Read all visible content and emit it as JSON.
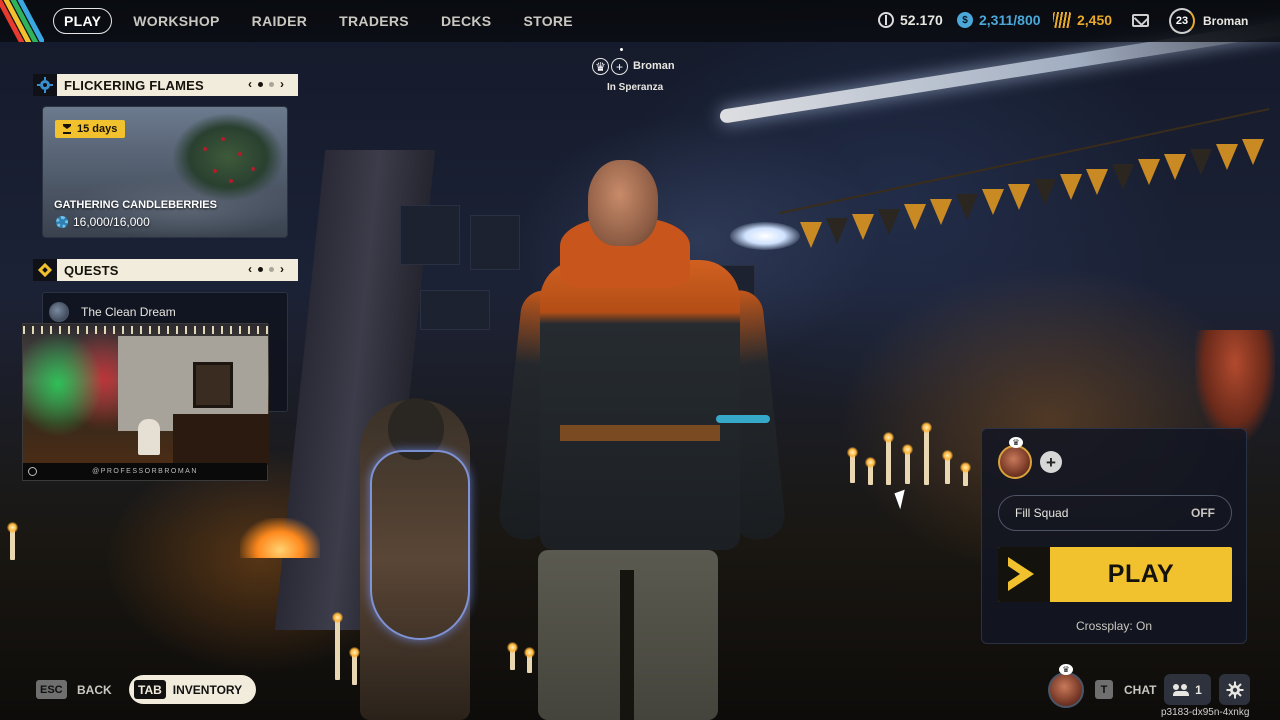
{
  "nav": {
    "items": [
      {
        "label": "PLAY",
        "active": true
      },
      {
        "label": "WORKSHOP",
        "active": false
      },
      {
        "label": "RAIDER",
        "active": false
      },
      {
        "label": "TRADERS",
        "active": false
      },
      {
        "label": "DECKS",
        "active": false
      },
      {
        "label": "STORE",
        "active": false
      }
    ]
  },
  "currencies": {
    "coins": "52.170",
    "blue": "2,311/800",
    "gold": "2,450"
  },
  "player": {
    "level": "23",
    "name": "Broman"
  },
  "party": {
    "leader": "Broman",
    "location": "In Speranza"
  },
  "event_panel": {
    "title": "FLICKERING FLAMES",
    "timer": "15 days",
    "event_name": "GATHERING CANDLEBERRIES",
    "progress": "16,000/16,000"
  },
  "quests_panel": {
    "title": "QUESTS",
    "quest_name": "The Clean Dream"
  },
  "webcam": {
    "handle": "@PROFESSORBROMAN"
  },
  "squad": {
    "fill_label": "Fill Squad",
    "fill_state": "OFF",
    "play_label": "PLAY",
    "crossplay": "Crossplay: On"
  },
  "bottom": {
    "esc_key": "ESC",
    "back_label": "BACK",
    "tab_key": "TAB",
    "inventory_label": "INVENTORY",
    "chat_key": "T",
    "chat_label": "CHAT",
    "friends_count": "1",
    "build_id": "p3183-dx95n-4xnkg"
  },
  "colors": {
    "accent_yellow": "#f2c12e",
    "panel_cream": "#f1ecdc",
    "blue_currency": "#4ba8d8",
    "gold_currency": "#e9a92a"
  },
  "icons": {
    "coins": "coin-icon",
    "blue": "blueprint-icon",
    "gold": "gold-bars-icon",
    "mail": "mail-icon",
    "settings": "gear-icon",
    "friends": "friends-icon"
  }
}
